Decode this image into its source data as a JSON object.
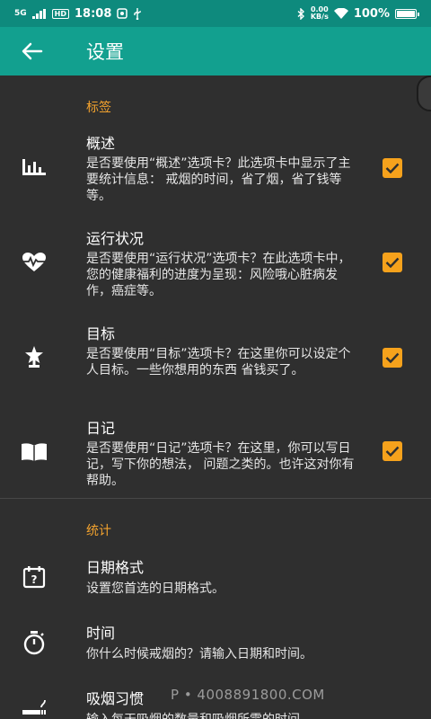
{
  "status_bar": {
    "time": "18:08",
    "network": "5G",
    "hd": "HD",
    "speed_value": "0.00",
    "speed_unit": "KB/s",
    "battery": "100%"
  },
  "app_bar": {
    "title": "设置",
    "back_icon": "arrow-left-icon"
  },
  "sections": [
    {
      "title": "标签"
    },
    {
      "title": "统计"
    }
  ],
  "tab_items": [
    {
      "title": "概述",
      "desc": "是否要使用“概述”选项卡？此选项卡中显示了主要统计信息： 戒烟的时间，省了烟，省了钱等等。",
      "icon": "bar-chart-icon",
      "checked": true
    },
    {
      "title": "运行状况",
      "desc": "是否要使用“运行状况”选项卡？在此选项卡中，您的健康福利的进度为呈现：风险哦心脏病发作，癌症等。",
      "icon": "heart-pulse-icon",
      "checked": true
    },
    {
      "title": "目标",
      "desc": "是否要使用“目标”选项卡？在这里你可以设定个人目标。一些你想用的东西 省钱买了。",
      "icon": "star-trophy-icon",
      "checked": true
    },
    {
      "title": "日记",
      "desc": "是否要使用“日记”选项卡？在这里，你可以写日记，写下你的想法， 问题之类的。也许这对你有帮助。",
      "icon": "open-book-icon",
      "checked": true
    }
  ],
  "stats_items": [
    {
      "title": "日期格式",
      "desc": "设置您首选的日期格式。",
      "icon": "calendar-question-icon"
    },
    {
      "title": "时间",
      "desc": "你什么时候戒烟的？请输入日期和时间。",
      "icon": "stopwatch-icon"
    },
    {
      "title": "吸烟习惯",
      "desc": "输入每天吸烟的数量和吸烟所需的时间",
      "icon": "cigarette-icon"
    }
  ],
  "watermark": "P • 4008891800.COM"
}
